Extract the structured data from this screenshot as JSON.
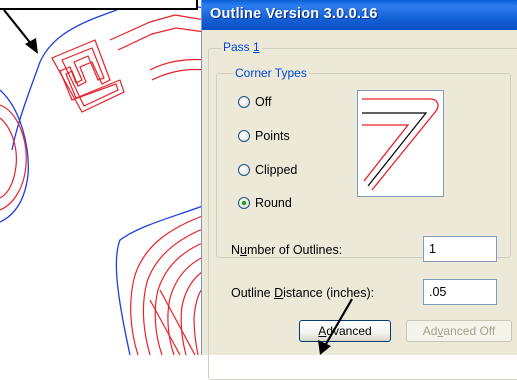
{
  "dialog": {
    "title": "Outline Version 3.0.0.16",
    "pass_group": {
      "prefix": "Pass ",
      "number": "1"
    },
    "corner_types": {
      "legend": "Corner Types",
      "options": [
        {
          "label": "Off",
          "checked": false
        },
        {
          "label": "Points",
          "checked": false
        },
        {
          "label": "Clipped",
          "checked": false
        },
        {
          "label": "Round",
          "checked": true
        }
      ]
    },
    "number_of_outlines": {
      "label_pre": "N",
      "label_u": "u",
      "label_post": "mber of Outlines:",
      "value": "1"
    },
    "outline_distance": {
      "label_pre": "Outline ",
      "label_u": "D",
      "label_post": "istance (inches):",
      "value": ".05"
    },
    "advanced_button": {
      "pre": "",
      "u": "A",
      "post": "dvanced"
    },
    "advanced_off_button": {
      "pre": "Ad",
      "u": "v",
      "post": "anced Off"
    }
  },
  "colors": {
    "outline_red": "#e8202a",
    "outline_blue": "#1d3fe0",
    "title_bar": "#0a5fd8",
    "dialog_bg": "#ece9d8"
  }
}
